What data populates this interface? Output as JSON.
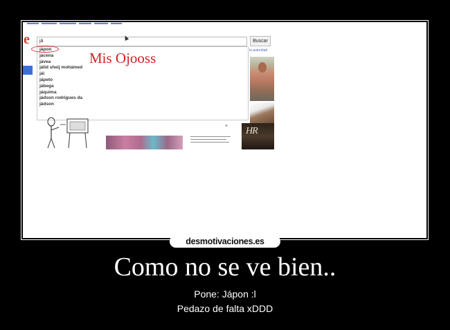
{
  "search": {
    "query": "já",
    "button_label": "Buscar",
    "suggestions": [
      "jápon",
      "jácena",
      "jávea",
      "jálid sheij mohámed",
      "jái",
      "jápeto",
      "jábega",
      "jáquima",
      "jádson rodrigues da",
      "jádson"
    ]
  },
  "annotation": "Mis Ojooss",
  "side_note": "la autoridad",
  "thumb_signature": "HR",
  "watermark": "desmotivaciones.es",
  "poster": {
    "title": "Como no se ve bien..",
    "caption_line1": "Pone: Jápon :l",
    "caption_line2": "Pedazo de falta xDDD"
  },
  "colors": {
    "background": "#000000",
    "annotation": "#d42020",
    "highlight_circle": "#dd2222",
    "accent_blue": "#3b6fe0"
  }
}
